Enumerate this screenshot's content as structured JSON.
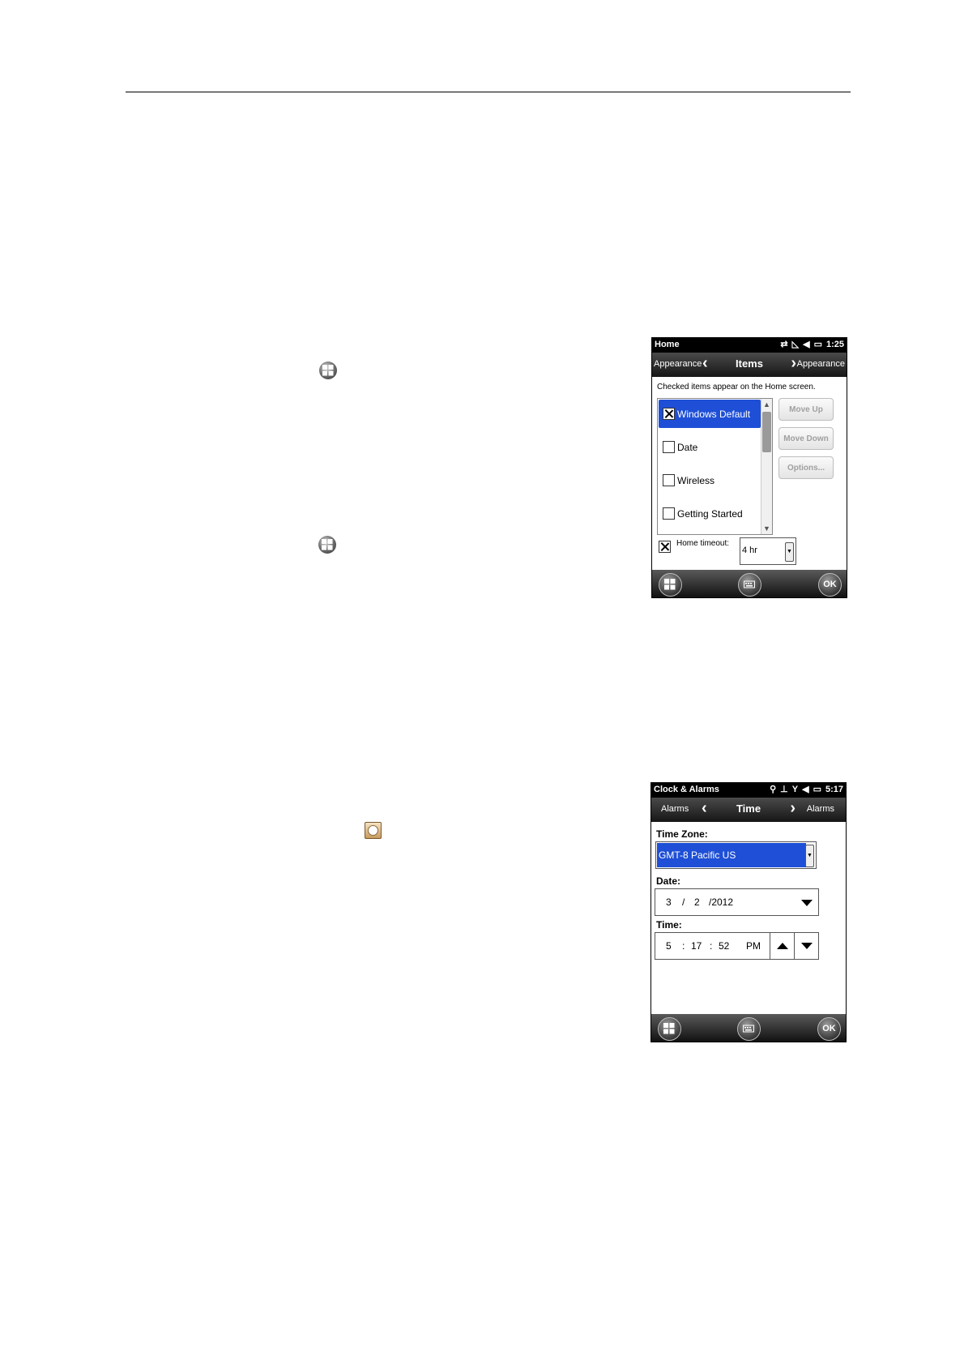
{
  "home_screen": {
    "status_title": "Home",
    "status_time": "1:25",
    "tabs": {
      "left": "Appearance",
      "center": "Items",
      "right": "Appearance"
    },
    "instruction": "Checked items appear on the Home screen.",
    "items": [
      {
        "label": "Windows Default",
        "checked": true,
        "selected": true
      },
      {
        "label": "Date",
        "checked": false,
        "selected": false
      },
      {
        "label": "Wireless",
        "checked": false,
        "selected": false
      },
      {
        "label": "Getting Started",
        "checked": false,
        "selected": false
      }
    ],
    "buttons": {
      "move_up": "Move Up",
      "move_down": "Move Down",
      "options": "Options..."
    },
    "timeout_label": "Home timeout:",
    "timeout_value": "4 hr",
    "ok": "OK"
  },
  "clock_screen": {
    "status_title": "Clock & Alarms",
    "status_time": "5:17",
    "tabs": {
      "left": "Alarms",
      "center": "Time",
      "right": "Alarms"
    },
    "time_zone_label": "Time Zone:",
    "time_zone_value": "GMT-8 Pacific US",
    "date_label": "Date:",
    "date": {
      "month": "3",
      "day": "2",
      "year": "/2012",
      "sep": "/"
    },
    "time_label": "Time:",
    "time": {
      "hour": "5",
      "minute": "17",
      "second": "52",
      "ampm": "PM",
      "sep": ":"
    },
    "ok": "OK"
  },
  "colors": {
    "selection_blue": "#1e4fd6",
    "bar_dark": "#161616"
  }
}
